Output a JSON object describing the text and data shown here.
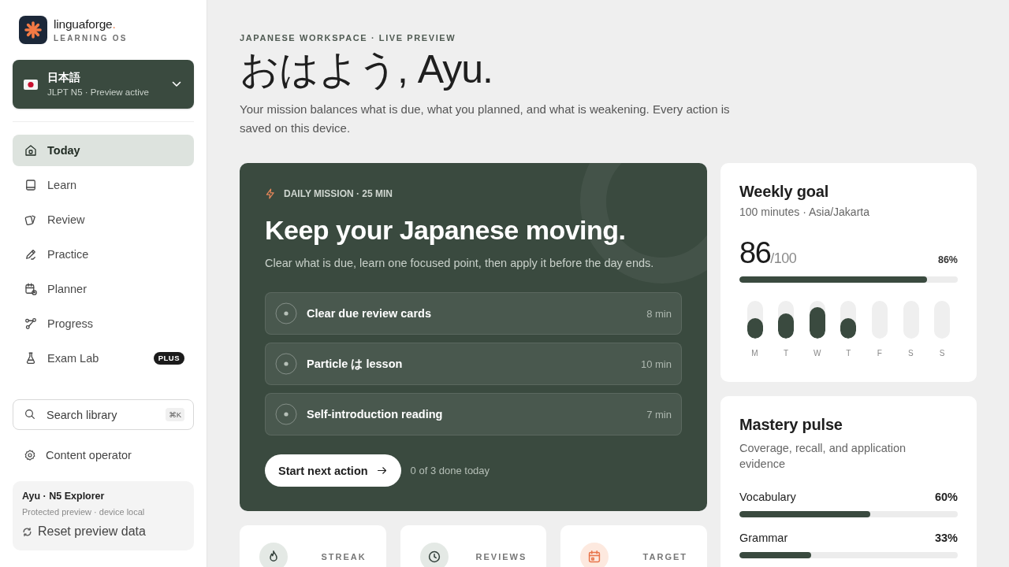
{
  "brand": {
    "name": "linguaforge",
    "accent": ".",
    "tagline": "LEARNING OS"
  },
  "language_selector": {
    "name": "日本語",
    "detail": "JLPT N5 · Preview active"
  },
  "nav": [
    {
      "label": "Today",
      "selected": true
    },
    {
      "label": "Learn",
      "selected": false
    },
    {
      "label": "Review",
      "selected": false
    },
    {
      "label": "Practice",
      "selected": false
    },
    {
      "label": "Planner",
      "selected": false
    },
    {
      "label": "Progress",
      "selected": false
    },
    {
      "label": "Exam Lab",
      "selected": false,
      "badge": "PLUS"
    }
  ],
  "search": {
    "placeholder": "Search library",
    "shortcut": "⌘K"
  },
  "settings_link": {
    "label": "Content operator"
  },
  "profile": {
    "name": "Ayu · N5 Explorer",
    "detail": "Protected preview · device local",
    "action": "Reset preview data"
  },
  "header": {
    "eyebrow": "JAPANESE WORKSPACE · LIVE PREVIEW",
    "title": "おはよう, Ayu.",
    "description": "Your mission balances what is due, what you planned, and what is weakening. Every action is saved on this device."
  },
  "mission": {
    "eyebrow": "DAILY MISSION · 25 MIN",
    "title": "Keep your Japanese moving.",
    "subtitle": "Clear what is due, learn one focused point, then apply it before the day ends.",
    "tasks": [
      {
        "label": "Clear due review cards",
        "duration": "8 min",
        "done": false
      },
      {
        "label": "Particle は lesson",
        "duration": "10 min",
        "done": false
      },
      {
        "label": "Self-introduction reading",
        "duration": "7 min",
        "done": false
      }
    ],
    "button": "Start next action",
    "progress": "0 of 3 done today"
  },
  "stats": [
    {
      "label": "STREAK"
    },
    {
      "label": "REVIEWS"
    },
    {
      "label": "TARGET"
    }
  ],
  "weekly": {
    "title": "Weekly goal",
    "subtitle": "100 minutes · Asia/Jakarta",
    "value": "86",
    "total": "/100",
    "percent": "86%",
    "level": 0.86,
    "days": [
      {
        "label": "M",
        "level": 0.55
      },
      {
        "label": "T",
        "level": 0.67
      },
      {
        "label": "W",
        "level": 0.83
      },
      {
        "label": "T",
        "level": 0.55
      },
      {
        "label": "F"
      },
      {
        "label": "S"
      },
      {
        "label": "S"
      }
    ]
  },
  "mastery": {
    "title": "Mastery pulse",
    "subtitle": "Coverage, recall, and application evidence",
    "skills": [
      {
        "name": "Vocabulary",
        "percent": "60%",
        "level": 0.6
      },
      {
        "name": "Grammar",
        "percent": "33%",
        "level": 0.33
      }
    ]
  }
}
